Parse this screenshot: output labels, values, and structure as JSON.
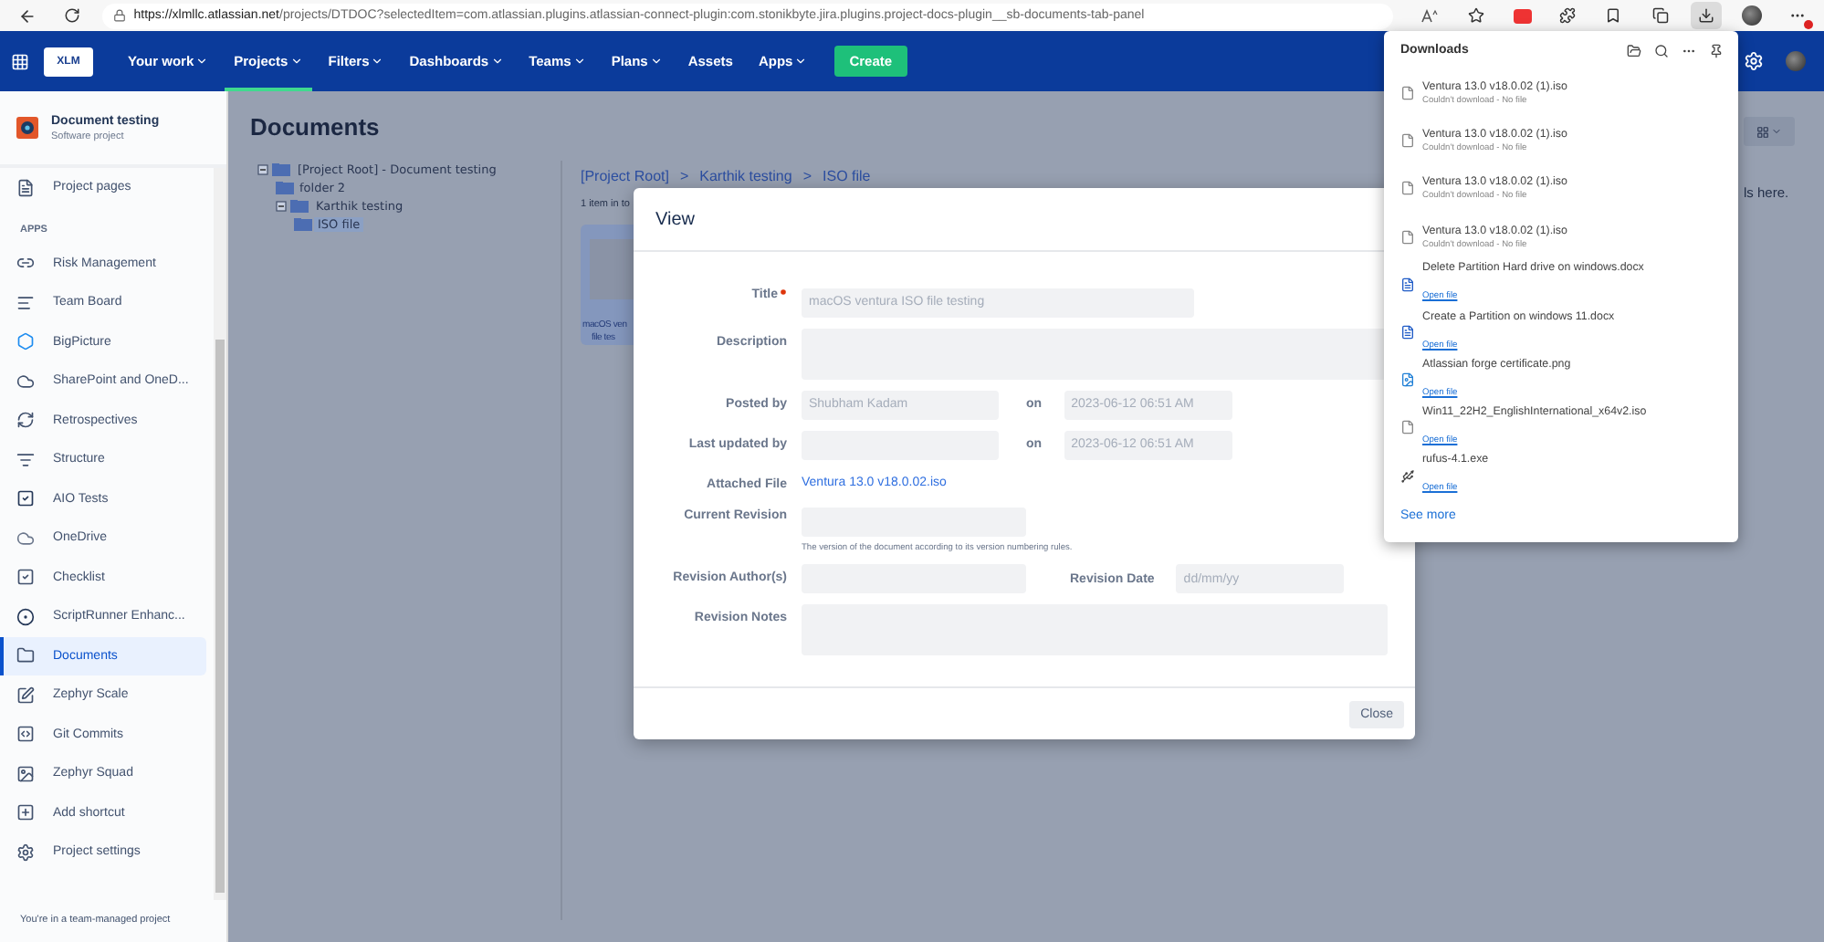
{
  "browser": {
    "url_host": "https://xlmllc.atlassian.net",
    "url_path": "/projects/DTDOC?selectedItem=com.atlassian.plugins.atlassian-connect-plugin:com.stonikbyte.jira.plugins.project-docs-plugin__sb-documents-tab-panel",
    "downloads_open": true
  },
  "nav": {
    "logo": "XLM",
    "items": [
      {
        "label": "Your work",
        "dropdown": true,
        "selected": false
      },
      {
        "label": "Projects",
        "dropdown": true,
        "selected": true
      },
      {
        "label": "Filters",
        "dropdown": true,
        "selected": false
      },
      {
        "label": "Dashboards",
        "dropdown": true,
        "selected": false
      },
      {
        "label": "Teams",
        "dropdown": true,
        "selected": false
      },
      {
        "label": "Plans",
        "dropdown": true,
        "selected": false
      },
      {
        "label": "Assets",
        "dropdown": false,
        "selected": false
      },
      {
        "label": "Apps",
        "dropdown": true,
        "selected": false
      }
    ],
    "create": "Create"
  },
  "sidebar": {
    "project": {
      "name": "Document testing",
      "type": "Software project"
    },
    "section": "APPS",
    "items": [
      {
        "label": "Project pages",
        "selected": false
      },
      {
        "label": "Risk Management",
        "selected": false
      },
      {
        "label": "Team Board",
        "selected": false
      },
      {
        "label": "BigPicture",
        "selected": false
      },
      {
        "label": "SharePoint and OneD...",
        "selected": false
      },
      {
        "label": "Retrospectives",
        "selected": false
      },
      {
        "label": "Structure",
        "selected": false
      },
      {
        "label": "AIO Tests",
        "selected": false
      },
      {
        "label": "OneDrive",
        "selected": false
      },
      {
        "label": "Checklist",
        "selected": false
      },
      {
        "label": "ScriptRunner Enhanc...",
        "selected": false
      },
      {
        "label": "Documents",
        "selected": true
      },
      {
        "label": "Zephyr Scale",
        "selected": false
      },
      {
        "label": "Git Commits",
        "selected": false
      },
      {
        "label": "Zephyr Squad",
        "selected": false
      },
      {
        "label": "Add shortcut",
        "selected": false
      },
      {
        "label": "Project settings",
        "selected": false
      }
    ],
    "footer": "You're in a team-managed project"
  },
  "main": {
    "title": "Documents",
    "tree": [
      {
        "label": "[Project Root] - Document testing",
        "expanded": true,
        "selected": false,
        "children": [
          {
            "label": "folder 2",
            "selected": false
          },
          {
            "label": "Karthik testing",
            "expanded": true,
            "selected": false,
            "children": [
              {
                "label": "ISO file",
                "selected": true
              }
            ]
          }
        ]
      }
    ],
    "breadcrumb": {
      "items": [
        "[Project Root]",
        "Karthik testing",
        "ISO file"
      ],
      "separator": ">"
    },
    "item_count": "1 item in to",
    "card": {
      "lines": [
        "macOS ven",
        "file tes"
      ]
    },
    "right_hint": "ls here."
  },
  "modal": {
    "title": "View",
    "fields": [
      {
        "label": "Title",
        "required": true,
        "kind": "text",
        "value": "macOS ventura ISO file testing"
      },
      {
        "label": "Description",
        "required": false,
        "kind": "textarea"
      },
      {
        "label": "Posted by",
        "required": false,
        "kind": "text_date",
        "value": "Shubham Kadam",
        "date_label": "on",
        "date": "2023-06-12 06:51 AM"
      },
      {
        "label": "Last updated by",
        "required": false,
        "kind": "text_date",
        "date_label": "on",
        "date": "2023-06-12 06:51 AM"
      },
      {
        "label": "Attached File",
        "required": false,
        "kind": "link",
        "value": "Ventura 13.0 v18.0.02.iso"
      },
      {
        "label": "Current Revision",
        "required": false,
        "kind": "text",
        "hint": "The version of the document according to its version numbering rules."
      },
      {
        "label": "Revision Author(s)",
        "required": false,
        "kind": "text_date",
        "date_label": "Revision Date",
        "date_placeholder": "dd/mm/yy"
      },
      {
        "label": "Revision Notes",
        "required": false,
        "kind": "textarea"
      }
    ],
    "close": "Close"
  },
  "downloads": {
    "title": "Downloads",
    "items": [
      {
        "name": "Ventura 13.0 v18.0.02 (1).iso",
        "kind": "failed",
        "status": "Couldn't download - No file"
      },
      {
        "name": "Ventura 13.0 v18.0.02 (1).iso",
        "kind": "failed",
        "status": "Couldn't download - No file"
      },
      {
        "name": "Ventura 13.0 v18.0.02 (1).iso",
        "kind": "failed",
        "status": "Couldn't download - No file"
      },
      {
        "name": "Ventura 13.0 v18.0.02 (1).iso",
        "kind": "failed",
        "status": "Couldn't download - No file"
      },
      {
        "name": "Delete Partition Hard drive on windows.docx",
        "kind": "done",
        "action": "Open file"
      },
      {
        "name": "Create a Partition on windows 11.docx",
        "kind": "done",
        "action": "Open file"
      },
      {
        "name": "Atlassian forge certificate.png",
        "kind": "done",
        "action": "Open file"
      },
      {
        "name": "Win11_22H2_EnglishInternational_x64v2.iso",
        "kind": "done",
        "action": "Open file"
      },
      {
        "name": "rufus-4.1.exe",
        "kind": "done",
        "action": "Open file"
      }
    ],
    "see_more": "See more"
  }
}
